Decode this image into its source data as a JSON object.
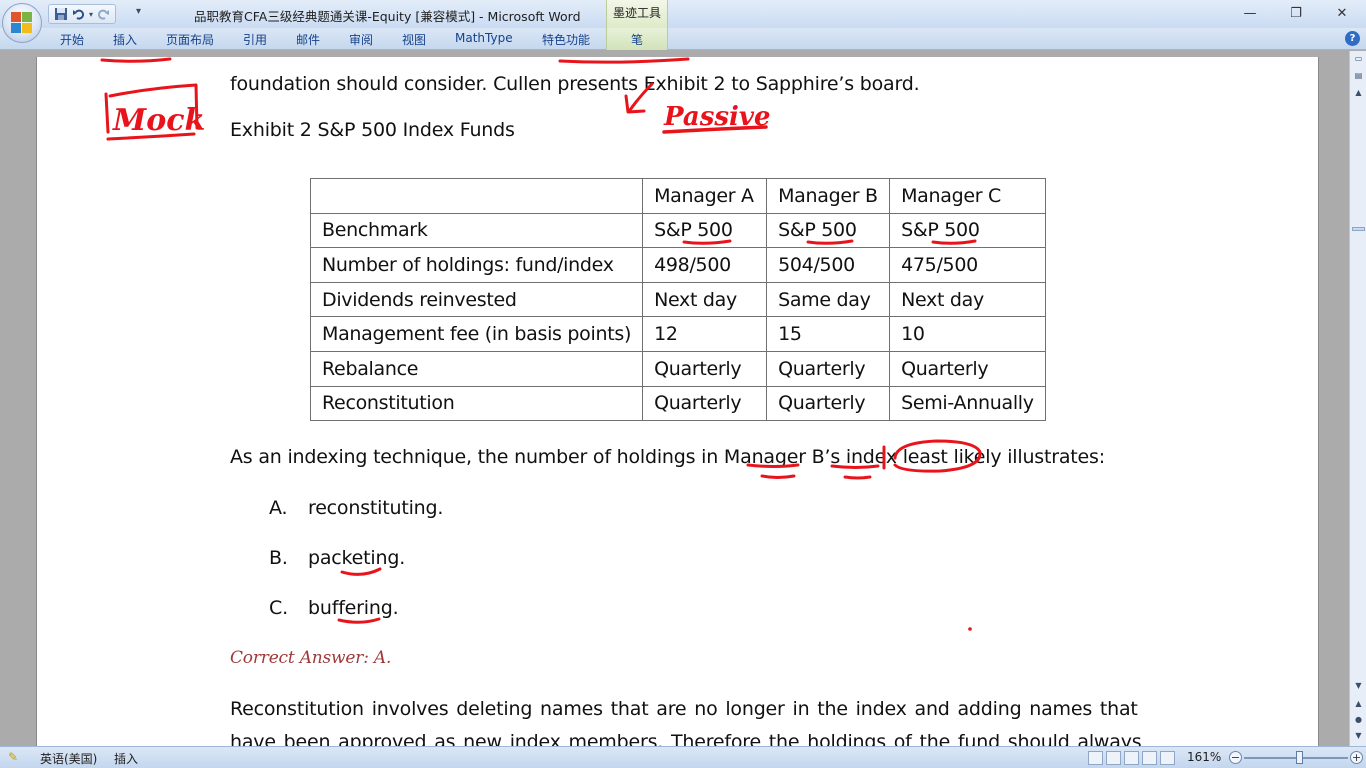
{
  "window": {
    "title": "品职教育CFA三级经典题通关课-Equity [兼容模式] - Microsoft Word",
    "context_tab_label": "墨迹工具",
    "controls": {
      "minimize": "—",
      "restore": "❐",
      "close": "✕"
    }
  },
  "quick_access": {
    "save_icon": "save-icon",
    "undo_icon": "undo-icon",
    "redo_icon": "redo-icon"
  },
  "ribbon": {
    "tabs": [
      "开始",
      "插入",
      "页面布局",
      "引用",
      "邮件",
      "审阅",
      "视图",
      "MathType",
      "特色功能",
      "笔"
    ],
    "help": "?"
  },
  "document": {
    "line1": "foundation should consider. Cullen presents Exhibit 2 to Sapphire’s board.",
    "exhibit_title": "Exhibit 2 S&P 500 Index Funds",
    "table": {
      "headers": [
        "",
        "Manager A",
        "Manager B",
        "Manager C"
      ],
      "rows": [
        [
          "Benchmark",
          "S&P 500",
          "S&P 500",
          "S&P 500"
        ],
        [
          "Number of holdings: fund/index",
          "498/500",
          "504/500",
          "475/500"
        ],
        [
          "Dividends reinvested",
          "Next day",
          "Same day",
          "Next day"
        ],
        [
          "Management fee (in basis points)",
          "12",
          "15",
          "10"
        ],
        [
          "Rebalance",
          "Quarterly",
          "Quarterly",
          "Quarterly"
        ],
        [
          "Reconstitution",
          "Quarterly",
          "Quarterly",
          "Semi-Annually"
        ]
      ]
    },
    "question": "As an indexing technique, the number of holdings in Manager B’s index least likely illustrates:",
    "options": [
      {
        "letter": "A.",
        "text": "reconstituting."
      },
      {
        "letter": "B.",
        "text": "packeting."
      },
      {
        "letter": "C.",
        "text": "buffering."
      }
    ],
    "correct_answer": "Correct Answer: A.",
    "explanation_line1": "Reconstitution involves deleting names that are no longer in the index and adding names that",
    "explanation_line2": "have been approved as new index members. Therefore the holdings of the fund should always"
  },
  "ink_annotations": {
    "left_margin_word": "Mock",
    "passive_word": "Passive",
    "color": "#E8141C"
  },
  "statusbar": {
    "language": "英语(美国)",
    "insert_mode": "插入",
    "zoom": "161%"
  }
}
